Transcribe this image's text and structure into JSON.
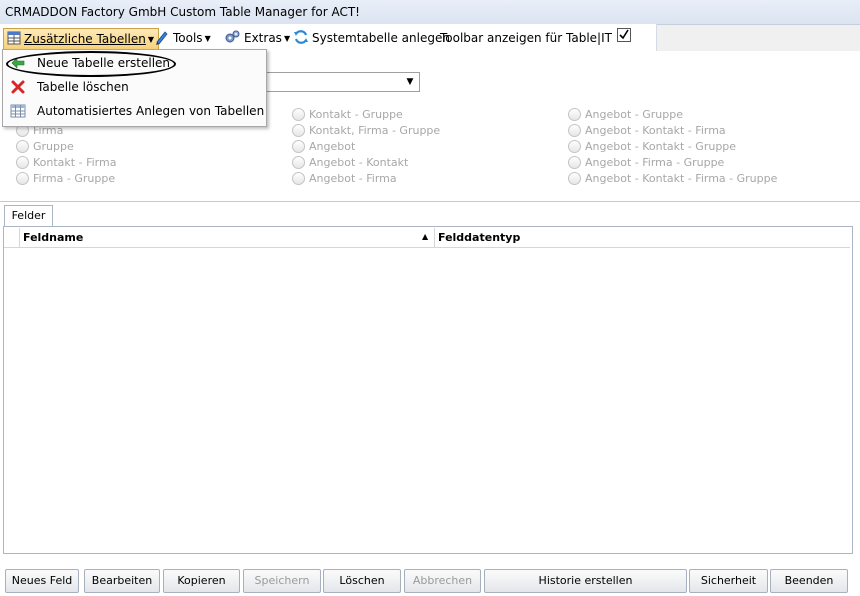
{
  "window": {
    "title": "CRMADDON Factory GmbH Custom Table Manager for ACT!"
  },
  "toolbar": {
    "zusaetzliche_tabellen": "Zusätzliche Tabellen",
    "tools": "Tools",
    "extras": "Extras",
    "systemtabelle": "Systemtabelle anlegen",
    "toolbar_anzeigen": "Toolbar anzeigen für Table|IT",
    "checkbox_checked": true
  },
  "menu": {
    "items": [
      {
        "label": "Neue Tabelle erstellen",
        "icon": "green-plus-icon"
      },
      {
        "label": "Tabelle löschen",
        "icon": "red-x-icon"
      },
      {
        "label": "Automatisiertes Anlegen von Tabellen",
        "icon": "table-grid-icon"
      }
    ]
  },
  "radios": {
    "col1": [
      "Firma",
      "Gruppe",
      "Kontakt - Firma",
      "Firma - Gruppe"
    ],
    "col2": [
      "Kontakt - Gruppe",
      "Kontakt, Firma - Gruppe",
      "Angebot",
      "Angebot - Kontakt",
      "Angebot - Firma"
    ],
    "col3": [
      "Angebot - Gruppe",
      "Angebot - Kontakt - Firma",
      "Angebot - Kontakt - Gruppe",
      "Angebot - Firma - Gruppe",
      "Angebot - Kontakt - Firma - Gruppe"
    ]
  },
  "tabs": {
    "felder": "Felder"
  },
  "grid": {
    "col_feldname": "Feldname",
    "col_felddatentyp": "Felddatentyp"
  },
  "buttons": {
    "neues_feld": "Neues Feld",
    "bearbeiten": "Bearbeiten",
    "kopieren": "Kopieren",
    "speichern": "Speichern",
    "loeschen": "Löschen",
    "abbrechen": "Abbrechen",
    "historie": "Historie erstellen",
    "sicherheit": "Sicherheit",
    "beenden": "Beenden"
  },
  "colors": {
    "accent": "#f7d27c",
    "disabled_text": "#a7a7a7"
  }
}
